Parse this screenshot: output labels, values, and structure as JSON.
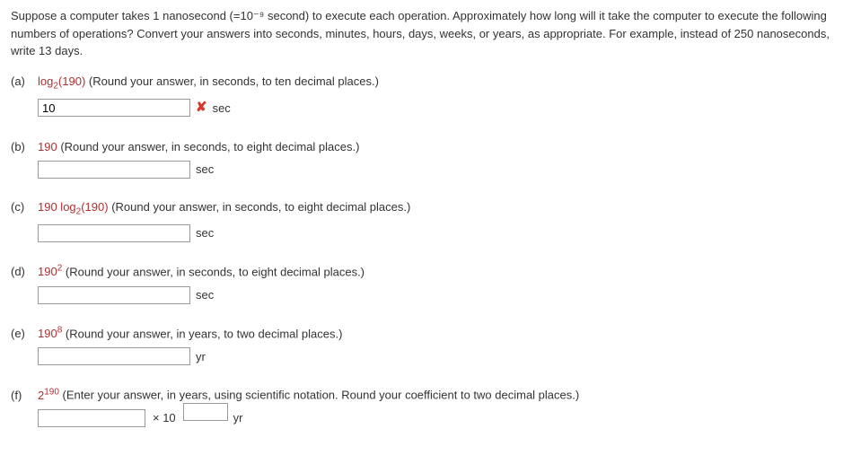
{
  "intro": "Suppose a computer takes 1 nanosecond (=10⁻⁹ second) to execute each operation. Approximately how long will it take the computer to execute the following numbers of operations? Convert your answers into seconds, minutes, hours, days, weeks, or years, as appropriate. For example, instead of 250 nanoseconds, write 13 days.",
  "parts": {
    "a": {
      "label": "(a)",
      "expr_html": "log<sub>2</sub>(190)",
      "instr": "(Round your answer, in seconds, to ten decimal places.)",
      "value": "10",
      "unit": "sec",
      "wrong": true
    },
    "b": {
      "label": "(b)",
      "expr_html": "190",
      "instr": "(Round your answer, in seconds, to eight decimal places.)",
      "value": "",
      "unit": "sec",
      "wrong": false
    },
    "c": {
      "label": "(c)",
      "expr_html": "190 log<sub>2</sub>(190)",
      "instr": "(Round your answer, in seconds, to eight decimal places.)",
      "value": "",
      "unit": "sec",
      "wrong": false
    },
    "d": {
      "label": "(d)",
      "expr_html": "190<sup>2</sup>",
      "instr": "(Round your answer, in seconds, to eight decimal places.)",
      "value": "",
      "unit": "sec",
      "wrong": false
    },
    "e": {
      "label": "(e)",
      "expr_html": "190<sup>8</sup>",
      "instr": "(Round your answer, in years, to two decimal places.)",
      "value": "",
      "unit": "yr",
      "wrong": false
    },
    "f": {
      "label": "(f)",
      "expr_html": "2<sup>190</sup>",
      "instr": "(Enter your answer, in years, using scientific notation. Round your coefficient to two decimal places.)",
      "coeff": "",
      "x10": "× 10",
      "exponent": "",
      "unit": "yr"
    }
  },
  "wrong_glyph": "✘"
}
